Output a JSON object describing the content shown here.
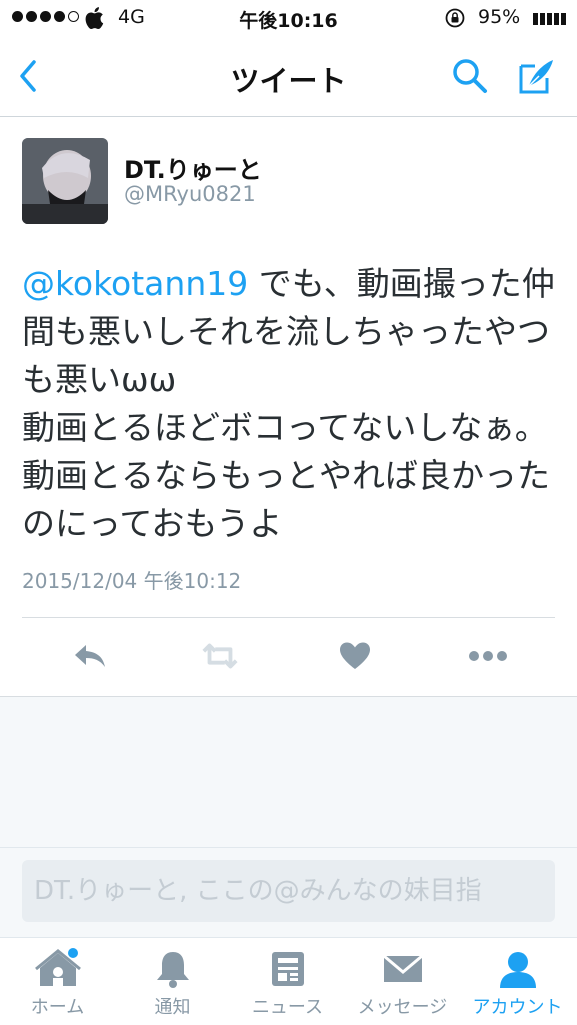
{
  "status_bar": {
    "carrier": "4G",
    "time": "午後10:16",
    "battery": "95%"
  },
  "nav": {
    "title": "ツイート"
  },
  "tweet": {
    "username": "DT.りゅーと",
    "handle": "@MRyu0821",
    "mention": "@kokotann19",
    "text": " でも、動画撮った仲間も悪いしそれを流しちゃったやつも悪いωω\n動画とるほどボコってないしなぁ。動画とるならもっとやれば良かったのにっておもうよ",
    "timestamp": "2015/12/04 午後10:12"
  },
  "actions": {
    "reply": "reply-icon",
    "retweet": "retweet-icon",
    "like": "heart-icon",
    "more": "more-icon"
  },
  "reply": {
    "placeholder": "DT.りゅーと, ここの@みんなの妹目指"
  },
  "tabs": [
    {
      "label": "ホーム",
      "icon": "home-icon"
    },
    {
      "label": "通知",
      "icon": "bell-icon"
    },
    {
      "label": "ニュース",
      "icon": "news-icon"
    },
    {
      "label": "メッセージ",
      "icon": "envelope-icon"
    },
    {
      "label": "アカウント",
      "icon": "person-icon"
    }
  ],
  "colors": {
    "accent": "#1da1f2",
    "muted": "#8899a6",
    "icon_gray": "#aab8c2"
  }
}
